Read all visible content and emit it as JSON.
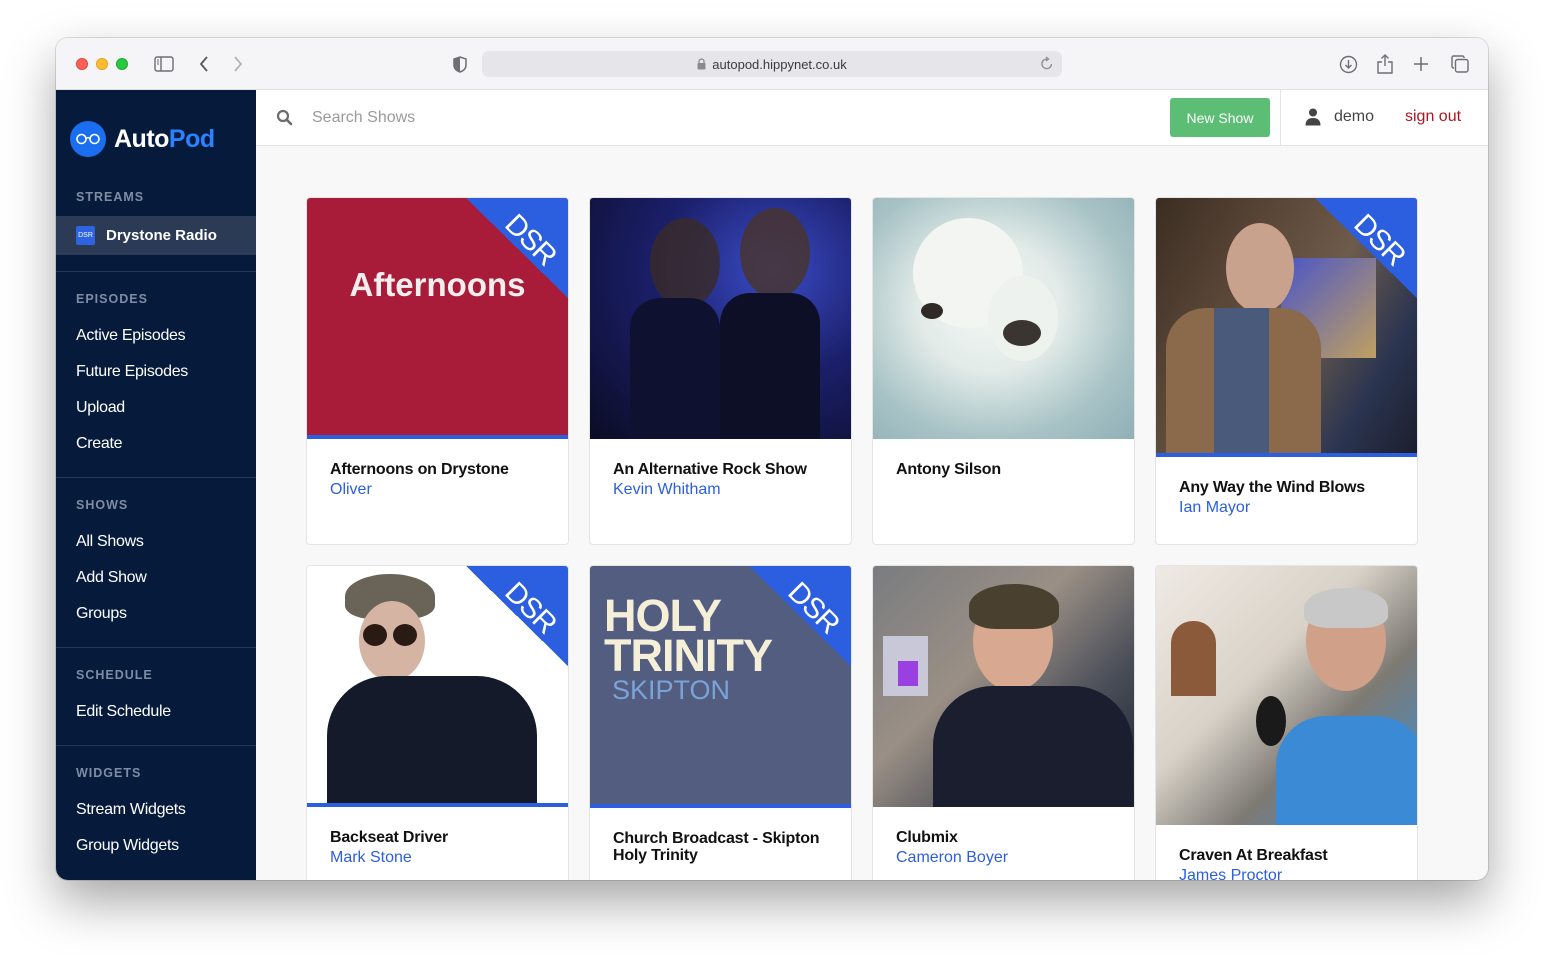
{
  "browser": {
    "url": "autopod.hippynet.co.uk",
    "icons": [
      "sidebar-toggle-icon",
      "back-icon",
      "forward-icon",
      "privacy-shield-icon",
      "lock-icon",
      "reload-icon",
      "download-icon",
      "share-icon",
      "new-tab-icon",
      "tab-overview-icon"
    ]
  },
  "brand": {
    "part1": "Auto",
    "part2": "Pod",
    "accent": "#2a82ff"
  },
  "sidebar": {
    "streams_heading": "STREAMS",
    "active_stream": {
      "badge": "DSR",
      "label": "Drystone Radio"
    },
    "sections": [
      {
        "heading": "EPISODES",
        "items": [
          "Active Episodes",
          "Future Episodes",
          "Upload",
          "Create"
        ]
      },
      {
        "heading": "SHOWS",
        "items": [
          "All Shows",
          "Add Show",
          "Groups"
        ]
      },
      {
        "heading": "SCHEDULE",
        "items": [
          "Edit Schedule"
        ]
      },
      {
        "heading": "WIDGETS",
        "items": [
          "Stream Widgets",
          "Group Widgets"
        ]
      }
    ]
  },
  "topbar": {
    "search_placeholder": "Search Shows",
    "search_value": "",
    "new_show_label": "New Show",
    "username": "demo",
    "sign_out_label": "sign out"
  },
  "colors": {
    "sidebar_bg": "#061b3c",
    "new_show_green": "#5cbd74",
    "sign_out_red": "#b0141f",
    "link_blue": "#2b5fe0",
    "ribbon_blue": "#2b5fe0"
  },
  "shows": [
    {
      "title": "Afternoons on Drystone",
      "host": "Oliver",
      "ribbon": "DSR",
      "image_text": "Afternoons",
      "image": "afternoons-artwork"
    },
    {
      "title": "An Alternative Rock Show",
      "host": "Kevin Whitham",
      "ribbon": "",
      "image": "guitarists-on-stage-photo"
    },
    {
      "title": "Antony Silson",
      "host": "",
      "ribbon": "",
      "image": "polar-bear-photo"
    },
    {
      "title": "Any Way the Wind Blows",
      "host": "Ian Mayor",
      "ribbon": "DSR",
      "image": "presenter-at-computer-photo"
    },
    {
      "title": "Backseat Driver",
      "host": "Mark Stone",
      "ribbon": "DSR",
      "image": "presenter-in-cap-photo"
    },
    {
      "title": "Church Broadcast - Skipton Holy Trinity",
      "host": "",
      "ribbon": "DSR",
      "image_text_1": "HOLY",
      "image_text_2": "TRINITY",
      "image_text_3": "SKIPTON",
      "image": "holy-trinity-artwork"
    },
    {
      "title": "Clubmix",
      "host": "Cameron Boyer",
      "ribbon": "",
      "image": "presenter-in-studio-photo"
    },
    {
      "title": "Craven At Breakfast",
      "host": "James Proctor",
      "ribbon": "",
      "image": "presenter-with-headphones-photo"
    }
  ]
}
